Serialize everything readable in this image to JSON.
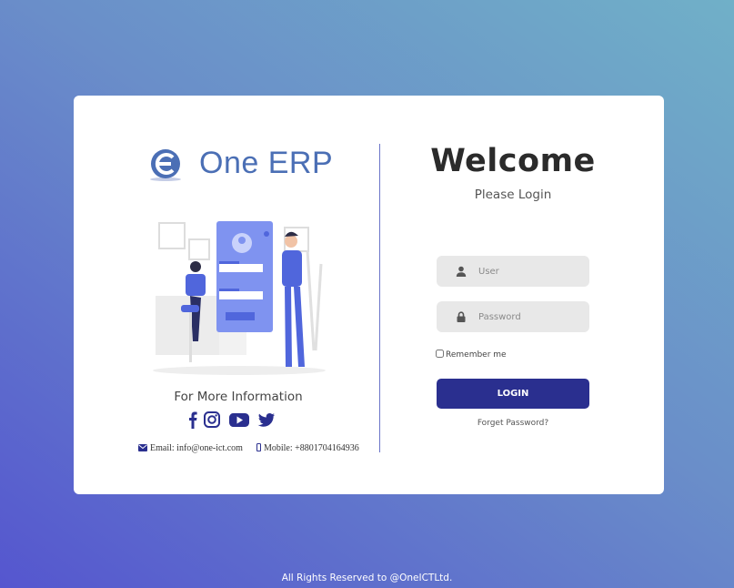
{
  "brand": {
    "name": "One ERP"
  },
  "info": {
    "title": "For More Information",
    "socials": [
      "facebook-icon",
      "instagram-icon",
      "youtube-icon",
      "twitter-icon"
    ],
    "email_label": "Email: info@one-ict.com",
    "mobile_label": "Mobile: +8801704164936"
  },
  "login": {
    "heading": "Welcome",
    "subheading": "Please Login",
    "user_placeholder": "User",
    "password_placeholder": "Password",
    "remember_label": "Remember me",
    "button_label": "LOGIN",
    "forget_label": "Forget Password?"
  },
  "footer": {
    "text": "All Rights Reserved to @OneICTLtd."
  },
  "colors": {
    "primary": "#2a2f8f",
    "brand": "#4b6fb5",
    "accent": "#5b6ee8"
  }
}
